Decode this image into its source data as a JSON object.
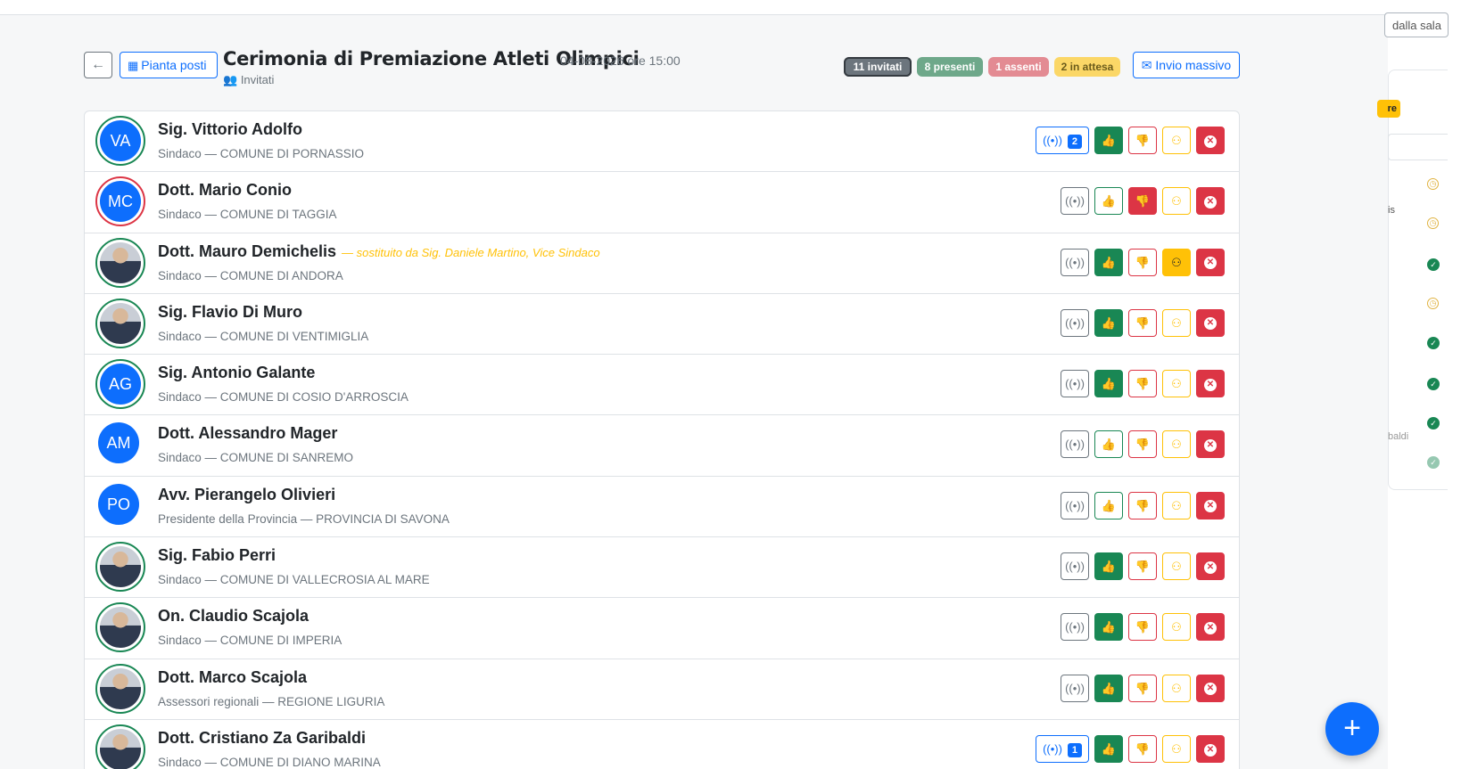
{
  "header": {
    "back_icon": "arrow-left-icon",
    "plan_label": "Pianta posti",
    "plan_icon": "grid-icon",
    "title": "Cerimonia di Premiazione Atleti Olimpici",
    "date": "04-08-2026 ore 15:00",
    "subtitle": "Invitati",
    "subtitle_icon": "people-icon",
    "stats": {
      "invitati": "11 invitati",
      "presenti": "8 presenti",
      "assenti": "1 assenti",
      "attesa": "2 in attesa"
    },
    "mass_label": "Invio massivo",
    "mass_icon": "envelope-icon"
  },
  "right_pane": {
    "sala_label": "dalla sala",
    "badge": "re",
    "frag1": "is",
    "frag2": "baldi"
  },
  "guests": [
    {
      "name": "Sig. Vittorio Adolfo",
      "role": "Sindaco — COMUNE DI PORNASSIO",
      "initials": "VA",
      "photo": false,
      "ring": "green",
      "signal_count": "2",
      "up": true,
      "down": false,
      "sub": false,
      "note": ""
    },
    {
      "name": "Dott. Mario Conio",
      "role": "Sindaco — COMUNE DI TAGGIA",
      "initials": "MC",
      "photo": false,
      "ring": "red",
      "signal_count": "",
      "up": false,
      "down": true,
      "sub": false,
      "note": ""
    },
    {
      "name": "Dott. Mauro Demichelis",
      "role": "Sindaco — COMUNE DI ANDORA",
      "initials": "",
      "photo": true,
      "ring": "green",
      "signal_count": "",
      "up": true,
      "down": false,
      "sub": true,
      "note": "— sostituito da Sig. Daniele Martino, Vice Sindaco"
    },
    {
      "name": "Sig. Flavio Di Muro",
      "role": "Sindaco — COMUNE DI VENTIMIGLIA",
      "initials": "",
      "photo": true,
      "ring": "green",
      "signal_count": "",
      "up": true,
      "down": false,
      "sub": false,
      "note": ""
    },
    {
      "name": "Sig. Antonio Galante",
      "role": "Sindaco — COMUNE DI COSIO D'ARROSCIA",
      "initials": "AG",
      "photo": false,
      "ring": "green",
      "signal_count": "",
      "up": true,
      "down": false,
      "sub": false,
      "note": ""
    },
    {
      "name": "Dott. Alessandro Mager",
      "role": "Sindaco — COMUNE DI SANREMO",
      "initials": "AM",
      "photo": false,
      "ring": "none",
      "signal_count": "",
      "up": false,
      "down": false,
      "sub": false,
      "note": ""
    },
    {
      "name": "Avv. Pierangelo Olivieri",
      "role": "Presidente della Provincia — PROVINCIA DI SAVONA",
      "initials": "PO",
      "photo": false,
      "ring": "none",
      "signal_count": "",
      "up": false,
      "down": false,
      "sub": false,
      "note": ""
    },
    {
      "name": "Sig. Fabio Perri",
      "role": "Sindaco — COMUNE DI VALLECROSIA AL MARE",
      "initials": "",
      "photo": true,
      "ring": "green",
      "signal_count": "",
      "up": true,
      "down": false,
      "sub": false,
      "note": ""
    },
    {
      "name": "On. Claudio Scajola",
      "role": "Sindaco — COMUNE DI IMPERIA",
      "initials": "",
      "photo": true,
      "ring": "green",
      "signal_count": "",
      "up": true,
      "down": false,
      "sub": false,
      "note": ""
    },
    {
      "name": "Dott. Marco Scajola",
      "role": "Assessori regionali — REGIONE LIGURIA",
      "initials": "",
      "photo": true,
      "ring": "green",
      "signal_count": "",
      "up": true,
      "down": false,
      "sub": false,
      "note": ""
    },
    {
      "name": "Dott. Cristiano Za Garibaldi",
      "role": "Sindaco — COMUNE DI DIANO MARINA",
      "initials": "",
      "photo": true,
      "ring": "green",
      "signal_count": "1",
      "up": true,
      "down": false,
      "sub": false,
      "note": ""
    }
  ],
  "icons": {
    "signal": "broadcast-icon",
    "up": "thumbs-up-icon",
    "down": "thumbs-down-icon",
    "sub": "person-swap-icon",
    "del": "x-circle-icon",
    "fab": "plus-icon"
  }
}
